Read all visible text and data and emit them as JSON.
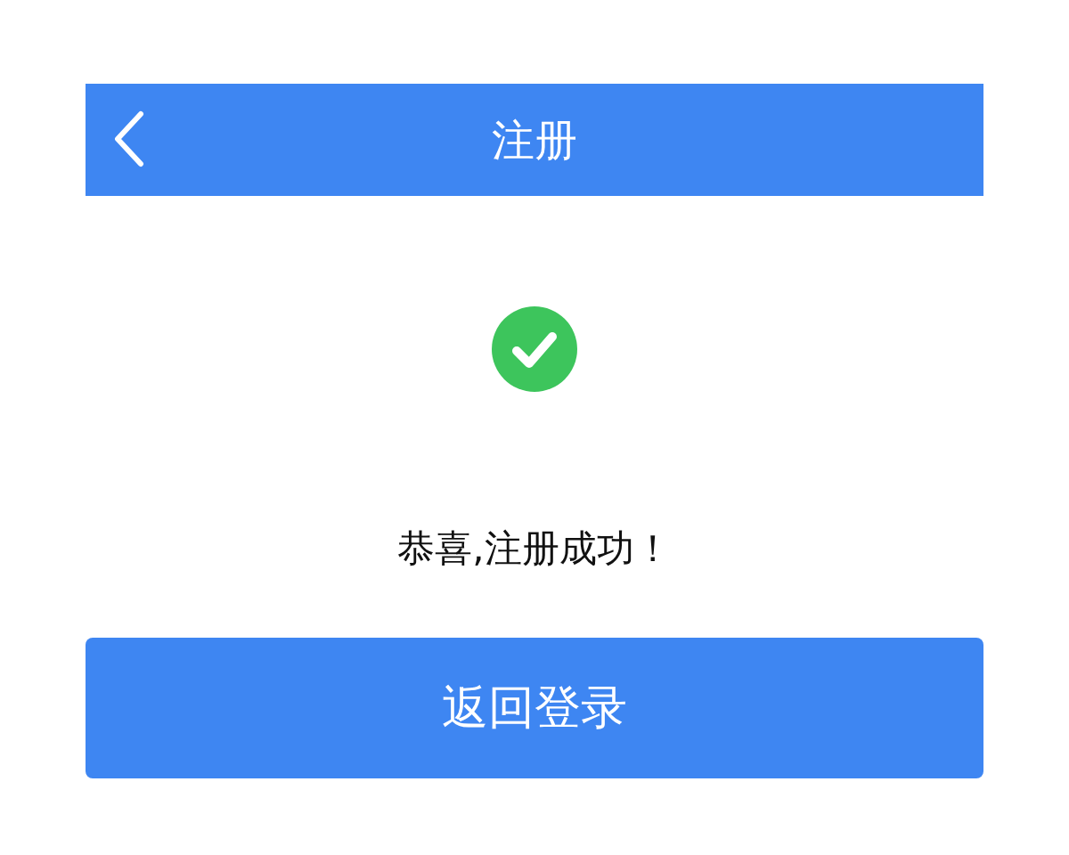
{
  "header": {
    "title": "注册"
  },
  "message": "恭喜,注册成功！",
  "button": {
    "label": "返回登录"
  }
}
